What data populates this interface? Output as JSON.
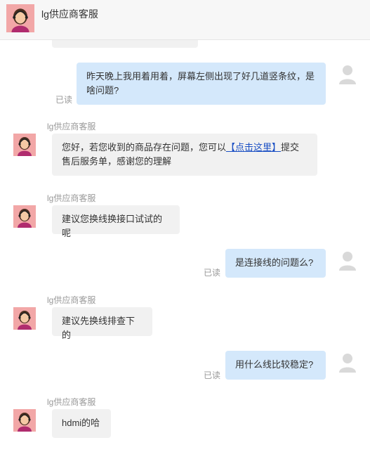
{
  "header": {
    "title": "lg供应商客服"
  },
  "messages": [
    {
      "type": "user",
      "text": "昨天晚上我用着用着，屏幕左侧出现了好几道竖条纹，是啥问题?",
      "read": "已读"
    },
    {
      "type": "agent",
      "sender": "lg供应商客服",
      "text_before": "您好，若您收到的商品存在问题，您可以",
      "link": "【点击这里】",
      "text_after": "提交售后服务单，感谢您的理解"
    },
    {
      "type": "agent",
      "sender": "lg供应商客服",
      "text": "建议您换线换接口试试的呢"
    },
    {
      "type": "user",
      "text": "是连接线的问题么?",
      "read": "已读"
    },
    {
      "type": "agent",
      "sender": "lg供应商客服",
      "text": "建议先换线排查下的"
    },
    {
      "type": "user",
      "text": "用什么线比较稳定?",
      "read": "已读"
    },
    {
      "type": "agent",
      "sender": "lg供应商客服",
      "text": "hdmi的哈"
    }
  ],
  "colors": {
    "user_bubble": "#d4e8fb",
    "agent_bubble": "#f1f1f1",
    "link": "#1a4fc4"
  },
  "icons": {
    "agent_avatar": "support-agent-avatar-icon",
    "user_avatar": "user-silhouette-icon"
  }
}
